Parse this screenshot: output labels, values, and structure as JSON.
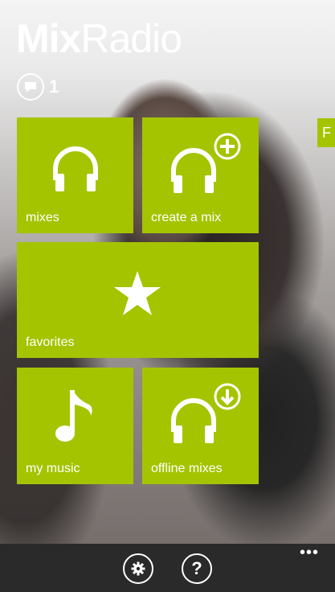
{
  "app": {
    "title_bold": "Mix",
    "title_light": "Radio"
  },
  "notifications": {
    "count": "1",
    "icon": "speech-bubble-icon"
  },
  "side_tab": {
    "label": "F"
  },
  "tiles": [
    {
      "label": "mixes",
      "icon": "headphones-icon"
    },
    {
      "label": "create a mix",
      "icon": "headphones-plus-icon"
    },
    {
      "label": "favorites",
      "icon": "star-icon"
    },
    {
      "label": "my music",
      "icon": "music-note-icon"
    },
    {
      "label": "offline mixes",
      "icon": "headphones-download-icon"
    }
  ],
  "appbar": {
    "settings_icon": "gear-icon",
    "help_label": "?",
    "more_label": "•••"
  },
  "colors": {
    "tile": "#a4c400",
    "appbar": "#2a2a2a",
    "text": "#ffffff"
  }
}
